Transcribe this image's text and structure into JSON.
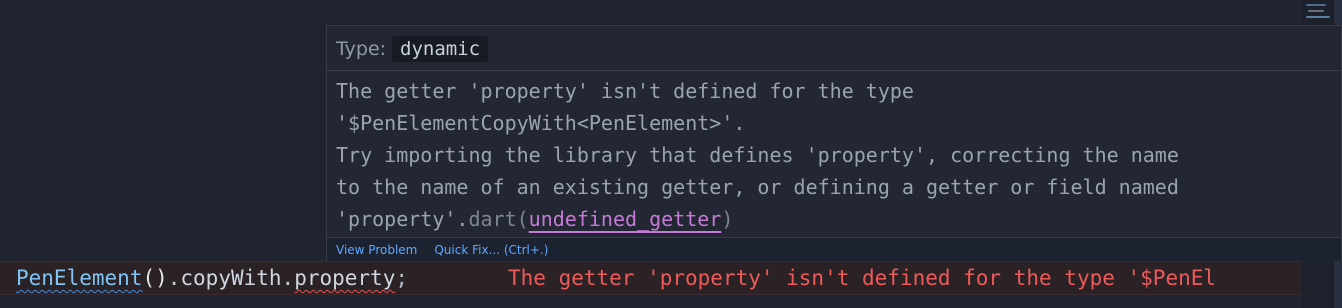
{
  "hover": {
    "type_label": "Type:",
    "type_value": "dynamic",
    "message_lines": [
      "The getter 'property' isn't defined for the type",
      "'$PenElementCopyWith<PenElement>'.",
      "Try importing the library that defines 'property', correcting the name",
      "to the name of an existing getter, or defining a getter or field named"
    ],
    "last_line_text": "'property'.",
    "source": "dart",
    "code_open": "(",
    "code": "undefined_getter",
    "code_close": ")",
    "actions": {
      "view_problem": "View Problem",
      "quick_fix": "Quick Fix... (Ctrl+.)"
    }
  },
  "code_line": {
    "class_name": "PenElement",
    "parens": "()",
    "dot1": ".",
    "member": "copyWith",
    "dot2": ".",
    "property": "property",
    "semicolon": ";",
    "inline_error": "The getter 'property' isn't defined for the type '$PenEl"
  },
  "colors": {
    "background": "#1f2430",
    "error": "#ee5a5a",
    "link": "#5ea8ff",
    "diagnostic_code": "#c57bd6"
  }
}
